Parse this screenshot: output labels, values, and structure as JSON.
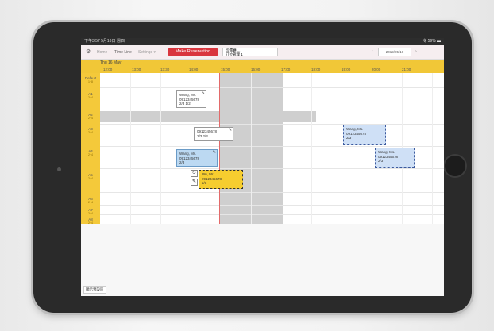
{
  "statusbar": {
    "left": "下午3:57  5月16日 週四",
    "right": "令 59% ▬"
  },
  "toolbar": {
    "logo": "⚙",
    "home": "Home",
    "timeline": "Time Line",
    "settings": "Settings ▾",
    "make_reservation": "Make Reservation",
    "shop_line1": "珍饌廳 ...",
    "shop_line2": "訂位管理 1",
    "prev": "‹",
    "date": "2019/05/16",
    "next": "›"
  },
  "header": {
    "date_label": "Thu 16 May",
    "hours": [
      "12:00",
      "13:00",
      "13:30",
      "14:00",
      "15:00",
      "16:00",
      "17:00",
      "18:00",
      "19:00",
      "20:00",
      "21:00"
    ]
  },
  "rows": [
    {
      "label": "Default",
      "sub": "1~8"
    },
    {
      "label": "A1",
      "sub": "2~4"
    },
    {
      "label": "A2",
      "sub": "2~4"
    },
    {
      "label": "A3",
      "sub": "2~4"
    },
    {
      "label": "A4",
      "sub": "2~4"
    },
    {
      "label": "A5",
      "sub": "2~4"
    },
    {
      "label": "A6",
      "sub": "2~4"
    },
    {
      "label": "A7",
      "sub": "2~4"
    },
    {
      "label": "A8",
      "sub": "2~4"
    }
  ],
  "cards": [
    {
      "name": "Wang, Ms.",
      "phone": "0912345678",
      "meta": "2/3  1/2",
      "style": "white"
    },
    {
      "name": "",
      "phone": "0912345678",
      "meta": "2/3  2/3",
      "style": "white"
    },
    {
      "name": "Wang, Ms.",
      "phone": "0912345678",
      "meta": "2/3",
      "style": "blue"
    },
    {
      "name": "Wu, Mr.",
      "phone": "0912345678",
      "meta": "2/3",
      "style": "yellow"
    },
    {
      "name": "Wang, Ms.",
      "phone": "0912345678",
      "meta": "2/3",
      "style": "dash"
    },
    {
      "name": "Wang, Ms.",
      "phone": "0912345678",
      "meta": "2/3",
      "style": "dash"
    }
  ],
  "footer": {
    "label": "顯示預設區"
  }
}
